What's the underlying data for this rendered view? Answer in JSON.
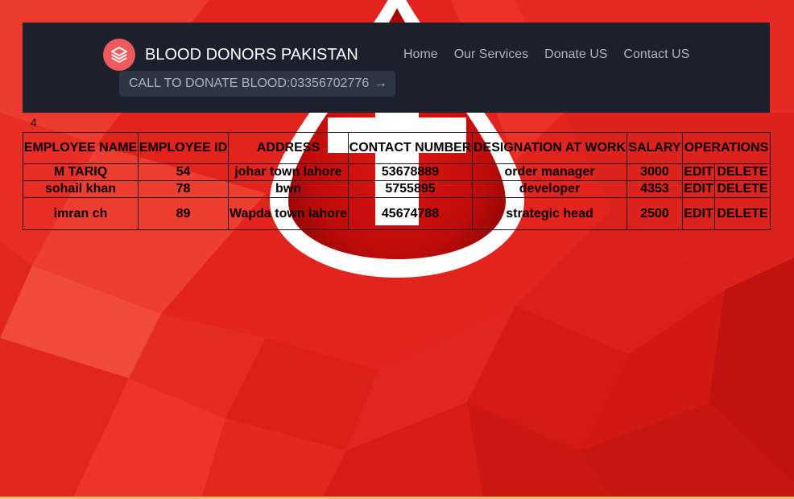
{
  "navbar": {
    "brand": "BLOOD DONORS PAKISTAN",
    "logo_icon": "layers-icon",
    "cta_label": "CALL TO DONATE BLOOD:03356702776",
    "cta_arrow": "→",
    "links": [
      {
        "label": "Home"
      },
      {
        "label": "Our Services"
      },
      {
        "label": "Donate US"
      },
      {
        "label": "Contact US"
      }
    ]
  },
  "record_count": "4",
  "table": {
    "headers": {
      "name": "EMPLOYEE NAME",
      "id": "EMPLOYEE ID",
      "address": "ADDRESS",
      "contact": "CONTACT NUMBER",
      "designation": "DESIGNATION AT WORK",
      "salary": "SALARY",
      "operations": "OPERATIONS"
    },
    "rows": [
      {
        "name": "M TARIQ",
        "id": "54",
        "address": "johar town lahore",
        "contact": "53678889",
        "designation": "order manager",
        "salary": "3000",
        "edit": "EDIT",
        "delete": "DELETE"
      },
      {
        "name": "sohail khan",
        "id": "78",
        "address": "bwn",
        "contact": "5755895",
        "designation": "developer",
        "salary": "4353",
        "edit": "EDIT",
        "delete": "DELETE"
      },
      {
        "name": "imran ch",
        "id": "89",
        "address": "Wapda town lahore",
        "contact": "45674788",
        "designation": "strategic head",
        "salary": "2500",
        "edit": "EDIT",
        "delete": "DELETE"
      }
    ]
  },
  "colors": {
    "background_red": "#e4241e",
    "navbar": "#1b202c",
    "logo": "#f05a5e",
    "cta_bg": "#2d3442",
    "nav_link": "#aeb3bd"
  }
}
